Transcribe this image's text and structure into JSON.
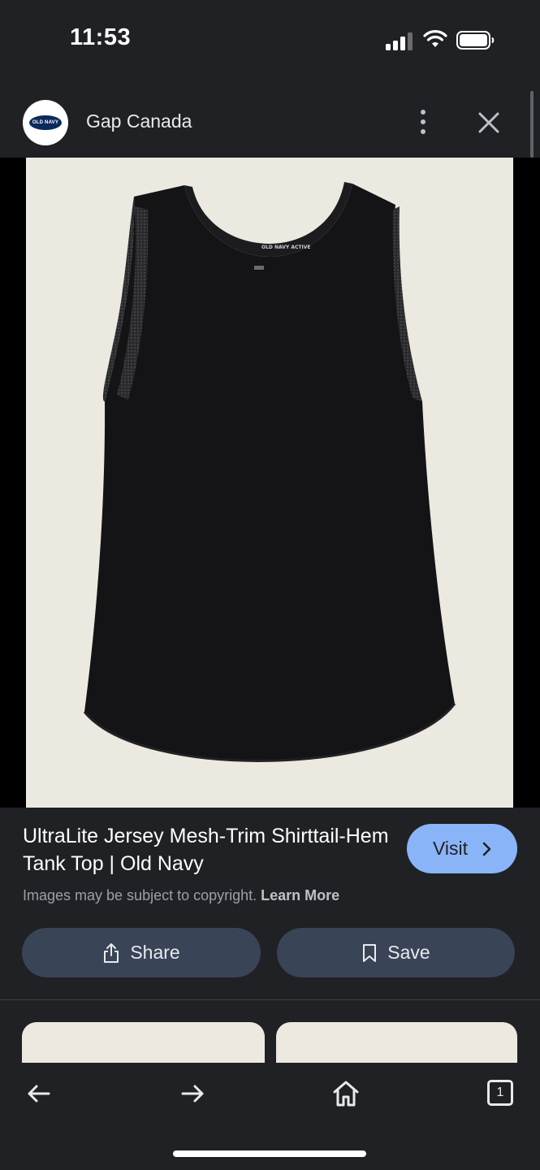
{
  "status_bar": {
    "time": "11:53"
  },
  "header": {
    "site_name": "Gap Canada",
    "logo_text": "OLD NAVY"
  },
  "product": {
    "image_alt": "Black mesh-trim tank top",
    "title": "UltraLite Jersey Mesh-Trim Shirttail-Hem Tank Top | Old Navy",
    "visit_label": "Visit",
    "copyright_text": "Images may be subject to copyright.",
    "learn_more_label": "Learn More",
    "share_label": "Share",
    "save_label": "Save"
  },
  "tabs": {
    "count": "1"
  },
  "icons": {
    "more": "more-vert-icon",
    "close": "close-icon",
    "share": "share-icon",
    "save": "bookmark-icon",
    "back": "arrow-left-icon",
    "forward": "arrow-right-icon",
    "home": "home-icon"
  },
  "colors": {
    "background": "#202124",
    "visit_button": "#8ab4f8",
    "action_button": "#394457",
    "image_background": "#ece9e1"
  }
}
